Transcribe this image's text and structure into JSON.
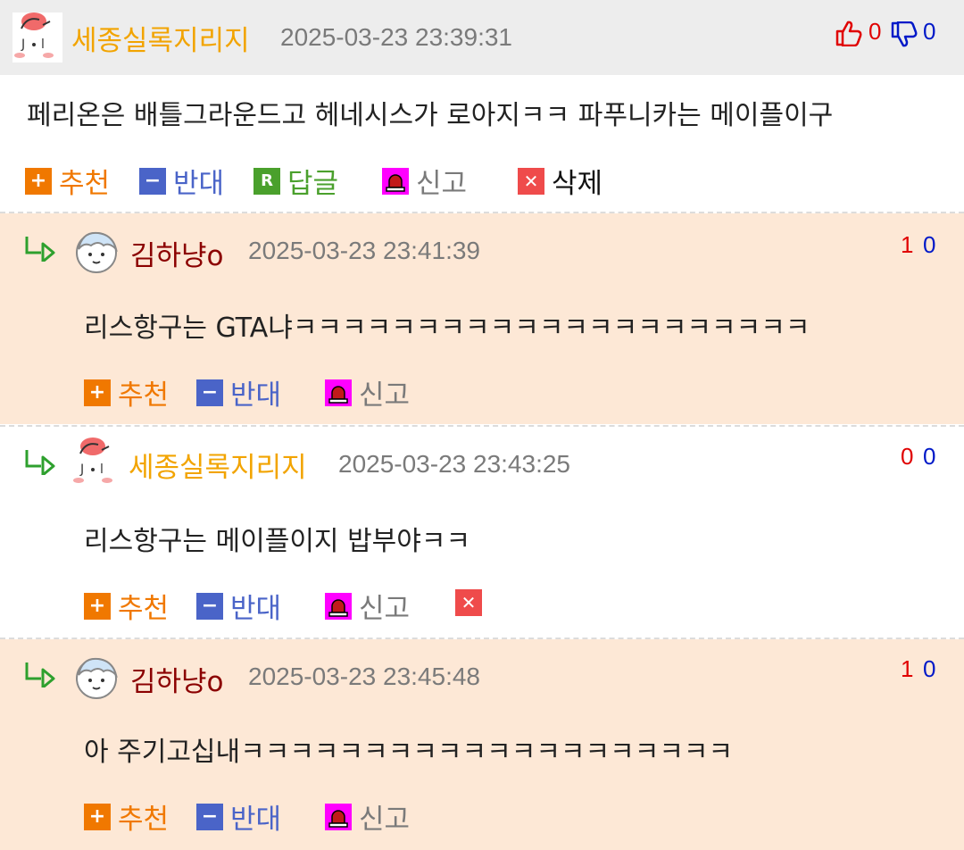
{
  "main_comment": {
    "author": "세종실록지리지",
    "timestamp": "2025-03-23 23:39:31",
    "likes": "0",
    "dislikes": "0",
    "text": "페리온은 배틀그라운드고 헤네시스가 로아지ㅋㅋ 파푸니카는 메이플이구",
    "actions": {
      "recommend": "추천",
      "oppose": "반대",
      "reply": "답글",
      "report": "신고",
      "delete": "삭제"
    }
  },
  "replies": [
    {
      "author": "김하냥o",
      "timestamp": "2025-03-23 23:41:39",
      "likes": "1",
      "dislikes": "0",
      "text": "리스항구는 GTA냐ㅋㅋㅋㅋㅋㅋㅋㅋㅋㅋㅋㅋㅋㅋㅋㅋㅋㅋㅋㅋㅋ",
      "recommend": "추천",
      "oppose": "반대",
      "report": "신고"
    },
    {
      "author": "세종실록지리지",
      "timestamp": "2025-03-23 23:43:25",
      "likes": "0",
      "dislikes": "0",
      "text": "리스항구는 메이플이지 밥부야ㅋㅋ",
      "recommend": "추천",
      "oppose": "반대",
      "report": "신고"
    },
    {
      "author": "김하냥o",
      "timestamp": "2025-03-23 23:45:48",
      "likes": "1",
      "dislikes": "0",
      "text": "아 주기고십내ㅋㅋㅋㅋㅋㅋㅋㅋㅋㅋㅋㅋㅋㅋㅋㅋㅋㅋㅋㅋ",
      "recommend": "추천",
      "oppose": "반대",
      "report": "신고"
    }
  ],
  "colors": {
    "author_gold": "#f2a400",
    "author_maroon": "#8b0000",
    "like_red": "#e00000",
    "dislike_blue": "#0019c8",
    "reply_bg": "#fde8d6",
    "header_bg": "#ededed"
  },
  "icons": {
    "like": "thumbs-up-icon",
    "dislike": "thumbs-down-icon",
    "recommend": "plus-icon",
    "oppose": "minus-icon",
    "reply": "r-reply-icon",
    "report": "siren-icon",
    "delete": "x-delete-icon",
    "reply_indent": "reply-arrow-icon"
  }
}
